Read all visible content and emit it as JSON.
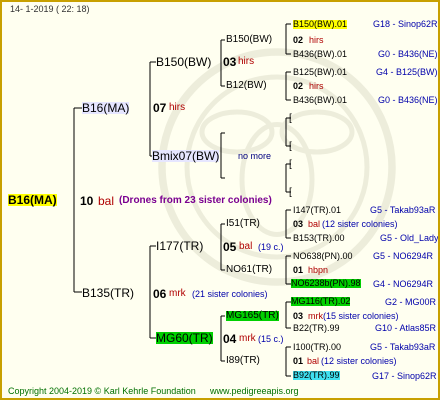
{
  "header": {
    "date": "14-   1-2019  (  22:  18)"
  },
  "footer": {
    "copyright": "Copyright 2004-2019 © Karl Kehrle Foundation",
    "site": "www.pedigreeapis.org"
  },
  "colors": {
    "frame": "#c8a000",
    "background": "#fffff0",
    "highlight_yellow": "#ffff00",
    "highlight_green": "#00d000",
    "highlight_cyan": "#40e0f0",
    "note_blue": "#0000aa",
    "note_purple": "#7a0090",
    "number_red": "#b00000"
  },
  "root": {
    "id": "B16(MA)",
    "num": "10",
    "label": "bal",
    "note": "(Drones from 23 sister colonies)"
  },
  "gen1": [
    {
      "id": "B16(MA)",
      "num": "07",
      "label": "hirs"
    },
    {
      "id": "B135(TR)",
      "num": "06",
      "label": "mrk",
      "note": "(21 sister colonies)"
    }
  ],
  "gen2": [
    {
      "id": "B150(BW)",
      "num": "03",
      "label": "hirs"
    },
    {
      "id": "Bmix07(BW)",
      "note": "no more"
    },
    {
      "id": "I177(TR)",
      "num": "05",
      "label": "bal",
      "note": "(19 c.)"
    },
    {
      "id": "MG60(TR)",
      "num": "04",
      "label": "mrk",
      "note": "(15 c.)"
    }
  ],
  "gen3": [
    {
      "id": "B150(BW)"
    },
    {
      "id": "B12(BW)"
    },
    {
      "id": "I51(TR)"
    },
    {
      "id": "NO61(TR)"
    },
    {
      "id": "MG165(TR)"
    },
    {
      "id": "I89(TR)"
    }
  ],
  "gen4": [
    {
      "id": "B150(BW).01",
      "line": "G18 - Sinop62R"
    },
    {
      "num": "02",
      "label": "hirs"
    },
    {
      "id": "B436(BW).01",
      "line": "G0 - B436(NE)"
    },
    {
      "id": "B125(BW).01",
      "line": "G4 - B125(BW)"
    },
    {
      "num": "02",
      "label": "hirs"
    },
    {
      "id": "B436(BW).01",
      "line": "G0 - B436(NE)"
    },
    {
      "id": "I147(TR).01",
      "line": "G5 - Takab93aR"
    },
    {
      "num": "03",
      "label": "bal",
      "note": "(12 sister colonies)"
    },
    {
      "id": "B153(TR).00",
      "line": "G5 - Old_Lady"
    },
    {
      "id": "NO638(PN).00",
      "line": "G5 - NO6294R"
    },
    {
      "num": "01",
      "label": "hbpn"
    },
    {
      "id": "NO6238b(PN).98",
      "line": "G4 - NO6294R"
    },
    {
      "id": "MG116(TR).02",
      "line": "G2 - MG00R"
    },
    {
      "num": "03",
      "label": "mrk",
      "note": "(15 sister colonies)"
    },
    {
      "id": "B22(TR).99",
      "line": "G10 - Atlas85R"
    },
    {
      "id": "I100(TR).00",
      "line": "G5 - Takab93aR"
    },
    {
      "num": "01",
      "label": "bal",
      "note": "(12 sister colonies)"
    },
    {
      "id": "B92(TR).99",
      "line": "G17 - Sinop62R"
    }
  ]
}
